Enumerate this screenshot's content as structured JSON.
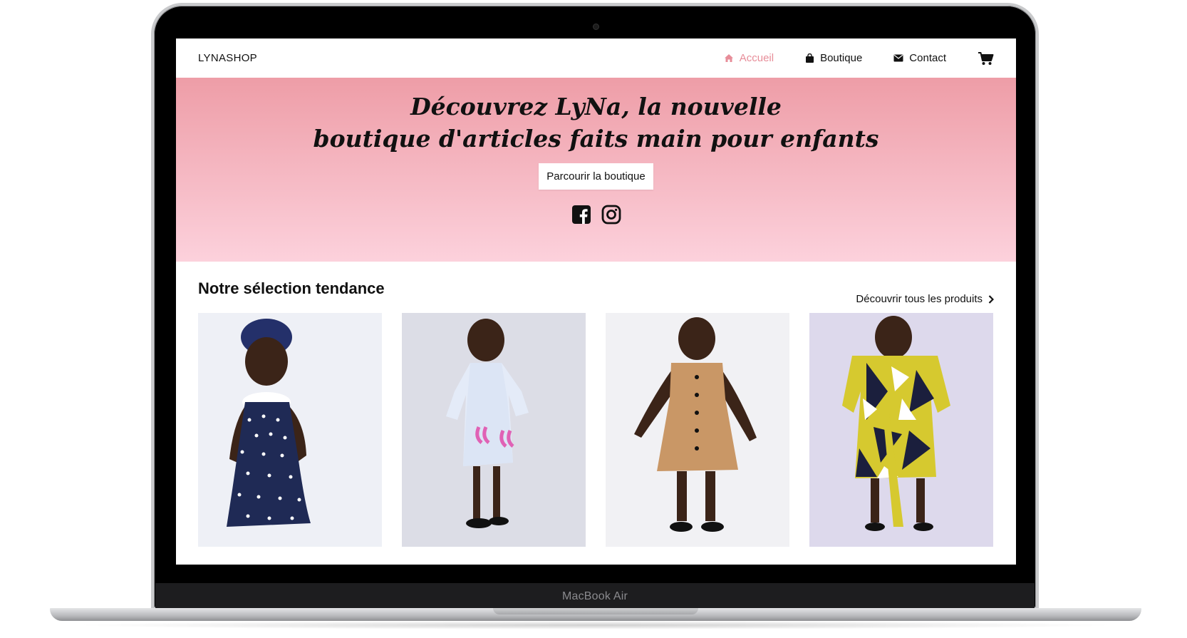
{
  "device": {
    "label": "MacBook Air"
  },
  "header": {
    "brand": "LYNASHOP",
    "nav": [
      {
        "label": "Accueil",
        "icon": "home-icon",
        "active": true
      },
      {
        "label": "Boutique",
        "icon": "shopping-bag-icon",
        "active": false
      },
      {
        "label": "Contact",
        "icon": "envelope-icon",
        "active": false
      }
    ],
    "cart_icon": "cart-icon"
  },
  "hero": {
    "title_line1": "Découvrez LyNa, la nouvelle",
    "title_line2": "boutique d'articles faits main pour enfants",
    "cta": "Parcourir la boutique",
    "socials": [
      "facebook-icon",
      "instagram-icon"
    ]
  },
  "products": {
    "title": "Notre sélection tendance",
    "all_link": "Découvrir tous les produits",
    "items": [
      {
        "name": "navy-polka-dot-dress",
        "dress_color": "#1f2a55",
        "price": ""
      },
      {
        "name": "light-blue-embroidered-dress",
        "dress_color": "#dfe6f4",
        "price": ""
      },
      {
        "name": "tan-button-dress",
        "dress_color": "#c99766",
        "price": ""
      },
      {
        "name": "wax-print-dress",
        "dress_color": "#d6c92f",
        "price": ""
      }
    ]
  },
  "colors": {
    "accent": "#e78d99",
    "hero_top": "#ee9da7",
    "hero_bottom": "#fcd1dc",
    "price": "#c3143c"
  }
}
